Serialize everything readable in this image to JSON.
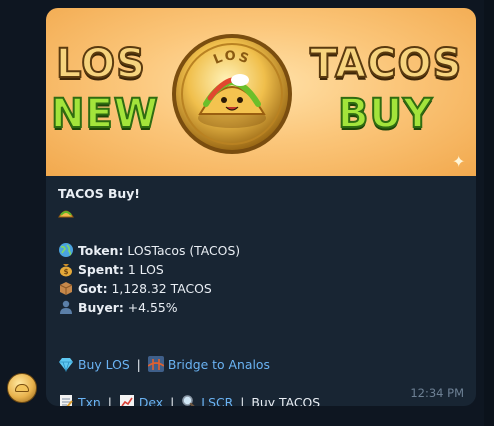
{
  "banner": {
    "word_top_left": "LOS",
    "word_top_right": "TACOS",
    "word_bottom_left": "NEW",
    "word_bottom_right": "BUY",
    "coin_text": "LOS"
  },
  "message": {
    "title": "TACOS Buy!",
    "token_label": "Token:",
    "token_value": "LOSTacos (TACOS)",
    "spent_label": "Spent:",
    "spent_value": "1 LOS",
    "got_label": "Got:",
    "got_value": "1,128.32 TACOS",
    "buyer_label": "Buyer:",
    "buyer_value": "+4.55%",
    "links_row1": {
      "buy_los": "Buy LOS",
      "separator": "|",
      "bridge": "Bridge to Analos"
    },
    "links_row2": {
      "txn": "Txn",
      "dex": "Dex",
      "lscr": "LSCR",
      "separator": "|",
      "buy_tacos": "Buy TACOS"
    },
    "time": "12:34 PM"
  },
  "colors": {
    "background": "#0e1621",
    "bubble": "#182533",
    "text": "#e9eef4",
    "link": "#6ab3f3",
    "time": "#6d8094"
  },
  "icons": {
    "taco": "taco-icon",
    "globe": "globe-icon",
    "money_bag": "money-bag-icon",
    "package": "package-icon",
    "buyer": "person-silhouette-icon",
    "gem": "gem-icon",
    "bridge": "bridge-icon",
    "receipt": "receipt-icon",
    "chart": "chart-icon",
    "magnifier": "magnifier-icon"
  }
}
